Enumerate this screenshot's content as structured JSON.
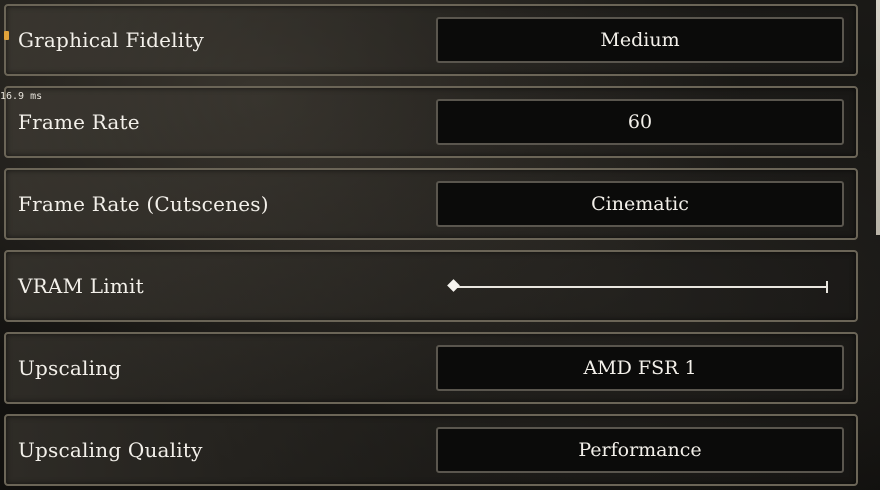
{
  "overlay": {
    "frame_time": "16.9 ms"
  },
  "settings": [
    {
      "label": "Graphical Fidelity",
      "value": "Medium",
      "control": "selector"
    },
    {
      "label": "Frame Rate",
      "value": "60",
      "control": "selector"
    },
    {
      "label": "Frame Rate (Cutscenes)",
      "value": "Cinematic",
      "control": "selector"
    },
    {
      "label": "VRAM Limit",
      "control": "slider",
      "slider_fraction": 0.0
    },
    {
      "label": "Upscaling",
      "value": "AMD FSR 1",
      "control": "selector"
    },
    {
      "label": "Upscaling Quality",
      "value": "Performance",
      "control": "selector"
    }
  ]
}
